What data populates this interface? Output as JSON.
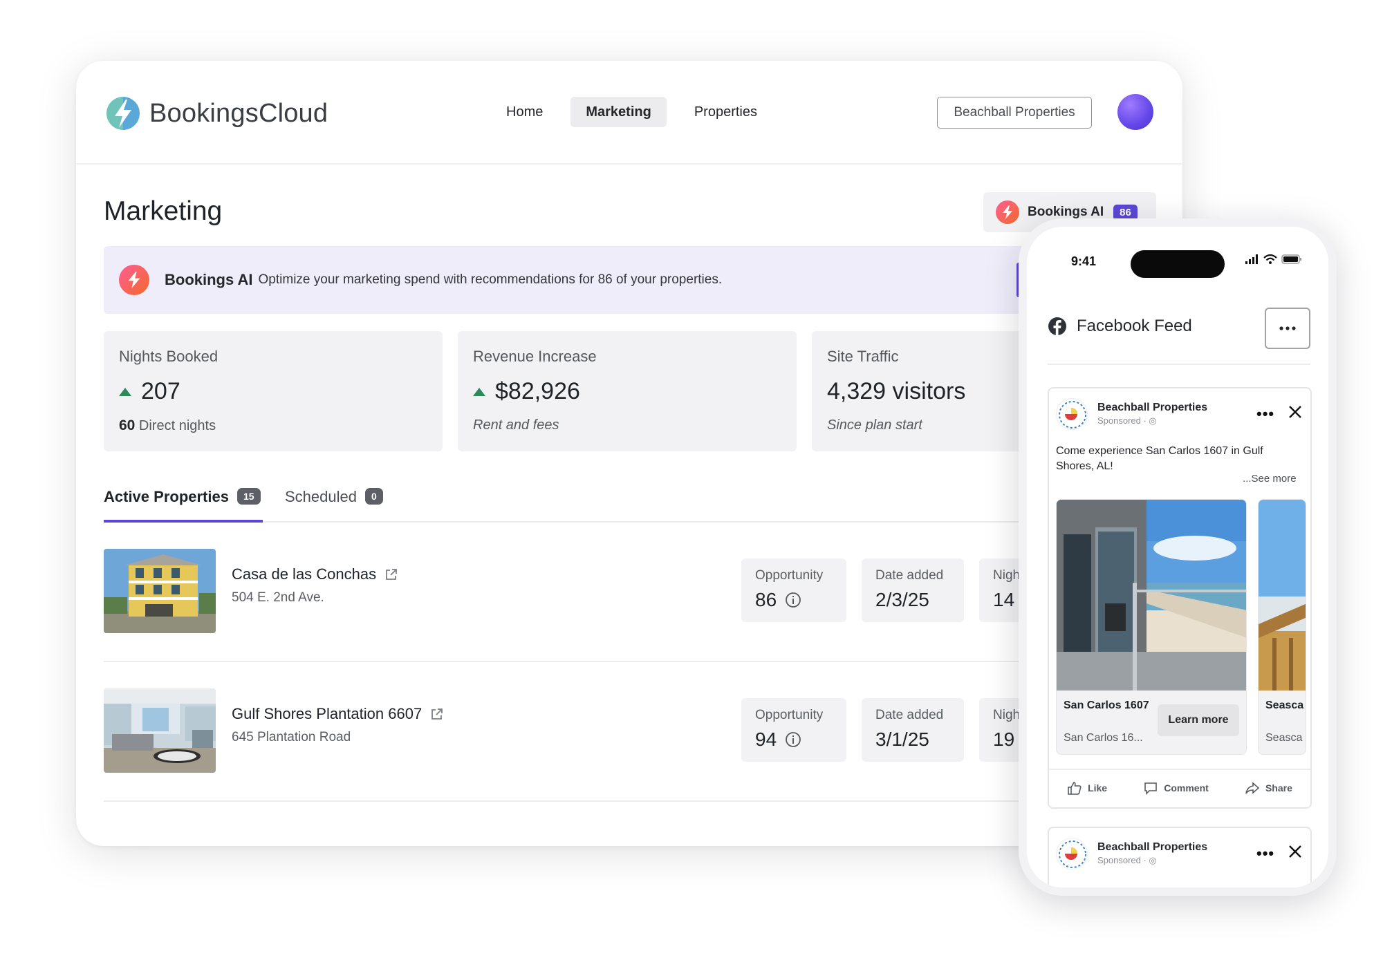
{
  "app": {
    "logo_text_1": "Bookings",
    "logo_text_2": "Cloud"
  },
  "nav": {
    "items": [
      {
        "label": "Home",
        "active": false
      },
      {
        "label": "Marketing",
        "active": true
      },
      {
        "label": "Properties",
        "active": false
      }
    ],
    "org_button": "Beachball Properties"
  },
  "page": {
    "title": "Marketing",
    "ai_pill_label": "Bookings AI",
    "ai_pill_count": "86"
  },
  "banner": {
    "title": "Bookings AI",
    "text": "Optimize your marketing spend with recommendations for 86 of your properties."
  },
  "metrics": [
    {
      "label": "Nights Booked",
      "value": "207",
      "trend": "up",
      "sub_strong": "60",
      "sub": "Direct nights"
    },
    {
      "label": "Revenue Increase",
      "value": "$82,926",
      "trend": "up",
      "sub": "Rent and fees"
    },
    {
      "label": "Site Traffic",
      "value": "4,329 visitors",
      "sub": "Since plan start"
    }
  ],
  "tabs": [
    {
      "label": "Active Properties",
      "count": "15",
      "active": true
    },
    {
      "label": "Scheduled",
      "count": "0",
      "active": false
    }
  ],
  "properties": [
    {
      "name": "Casa de las Conchas",
      "address": "504 E. 2nd Ave.",
      "opportunity_label": "Opportunity",
      "opportunity": "86",
      "date_label": "Date added",
      "date": "2/3/25",
      "nights_label": "Nigh",
      "nights": "14"
    },
    {
      "name": "Gulf Shores Plantation 6607",
      "address": "645 Plantation Road",
      "opportunity_label": "Opportunity",
      "opportunity": "94",
      "date_label": "Date added",
      "date": "3/1/25",
      "nights_label": "Nigh",
      "nights": "19"
    }
  ],
  "phone": {
    "time": "9:41",
    "feed_title": "Facebook Feed",
    "posts": [
      {
        "page_name": "Beachball Properties",
        "sponsored": "Sponsored · ◎",
        "text": "Come experience San Carlos 1607 in Gulf Shores, AL!",
        "see_more": "...See more",
        "cards": [
          {
            "title": "San Carlos 1607",
            "subtitle": "San Carlos 16...",
            "cta": "Learn more"
          },
          {
            "title": "Seasca",
            "subtitle": "Seasca"
          }
        ],
        "actions": [
          "Like",
          "Comment",
          "Share"
        ]
      },
      {
        "page_name": "Beachball Properties",
        "sponsored": "Sponsored · ◎"
      }
    ]
  },
  "colors": {
    "accent": "#5b47d6",
    "trend_up": "#2b8a5a",
    "banner_bg": "#efedfa",
    "card_bg": "#f2f2f4"
  },
  "icons": [
    "logo-bolt-icon",
    "bolt-icon",
    "trend-up-icon",
    "external-link-icon",
    "info-icon",
    "facebook-icon",
    "more-icon",
    "close-icon",
    "like-icon",
    "comment-icon",
    "share-icon",
    "signal-icon",
    "wifi-icon",
    "battery-icon"
  ]
}
